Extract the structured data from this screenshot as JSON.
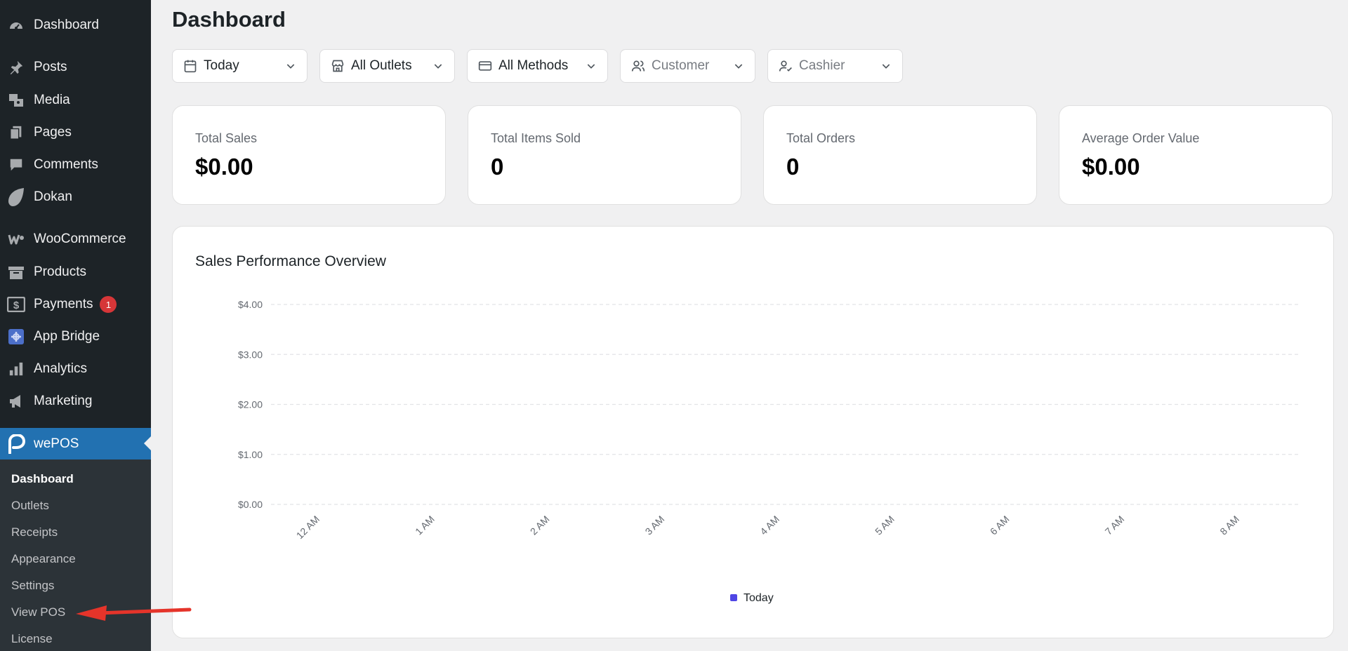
{
  "sidebar": {
    "items": [
      {
        "label": "Dashboard",
        "icon": "dashboard-icon"
      },
      {
        "label": "Posts",
        "icon": "pushpin-icon"
      },
      {
        "label": "Media",
        "icon": "media-icon"
      },
      {
        "label": "Pages",
        "icon": "pages-icon"
      },
      {
        "label": "Comments",
        "icon": "comment-icon"
      },
      {
        "label": "Dokan",
        "icon": "dokan-icon"
      },
      {
        "label": "WooCommerce",
        "icon": "woocommerce-icon"
      },
      {
        "label": "Products",
        "icon": "archive-icon"
      },
      {
        "label": "Payments",
        "icon": "payments-icon",
        "badge": "1"
      },
      {
        "label": "App Bridge",
        "icon": "app-bridge-icon"
      },
      {
        "label": "Analytics",
        "icon": "bar-chart-icon"
      },
      {
        "label": "Marketing",
        "icon": "megaphone-icon"
      }
    ],
    "active": {
      "label": "wePOS",
      "icon": "wepos-icon"
    },
    "submenu": [
      "Dashboard",
      "Outlets",
      "Receipts",
      "Appearance",
      "Settings",
      "View POS",
      "License"
    ]
  },
  "page": {
    "title": "Dashboard"
  },
  "filters": [
    {
      "label": "Today",
      "icon": "calendar-icon"
    },
    {
      "label": "All Outlets",
      "icon": "store-icon"
    },
    {
      "label": "All Methods",
      "icon": "credit-card-icon"
    },
    {
      "label": "Customer",
      "icon": "users-icon"
    },
    {
      "label": "Cashier",
      "icon": "user-check-icon"
    }
  ],
  "stats": [
    {
      "label": "Total Sales",
      "value": "$0.00"
    },
    {
      "label": "Total Items Sold",
      "value": "0"
    },
    {
      "label": "Total Orders",
      "value": "0"
    },
    {
      "label": "Average Order Value",
      "value": "$0.00"
    }
  ],
  "chart": {
    "title": "Sales Performance Overview"
  },
  "chart_data": {
    "type": "line",
    "title": "Sales Performance Overview",
    "xlabel": "",
    "ylabel": "",
    "x": [
      "12 AM",
      "1 AM",
      "2 AM",
      "3 AM",
      "4 AM",
      "5 AM",
      "6 AM",
      "7 AM",
      "8 AM"
    ],
    "y_ticks": [
      "$0.00",
      "$1.00",
      "$2.00",
      "$3.00",
      "$4.00"
    ],
    "ylim": [
      0,
      4
    ],
    "grid": true,
    "legend_position": "bottom",
    "series": [
      {
        "name": "Today",
        "values": [
          0,
          0,
          0,
          0,
          0,
          0,
          0,
          0,
          0
        ],
        "color": "#4f46e5"
      }
    ]
  },
  "colors": {
    "sidebar_bg": "#1d2327",
    "active_bg": "#2271b1",
    "badge": "#d63638",
    "annotation_arrow": "#e5342a"
  }
}
